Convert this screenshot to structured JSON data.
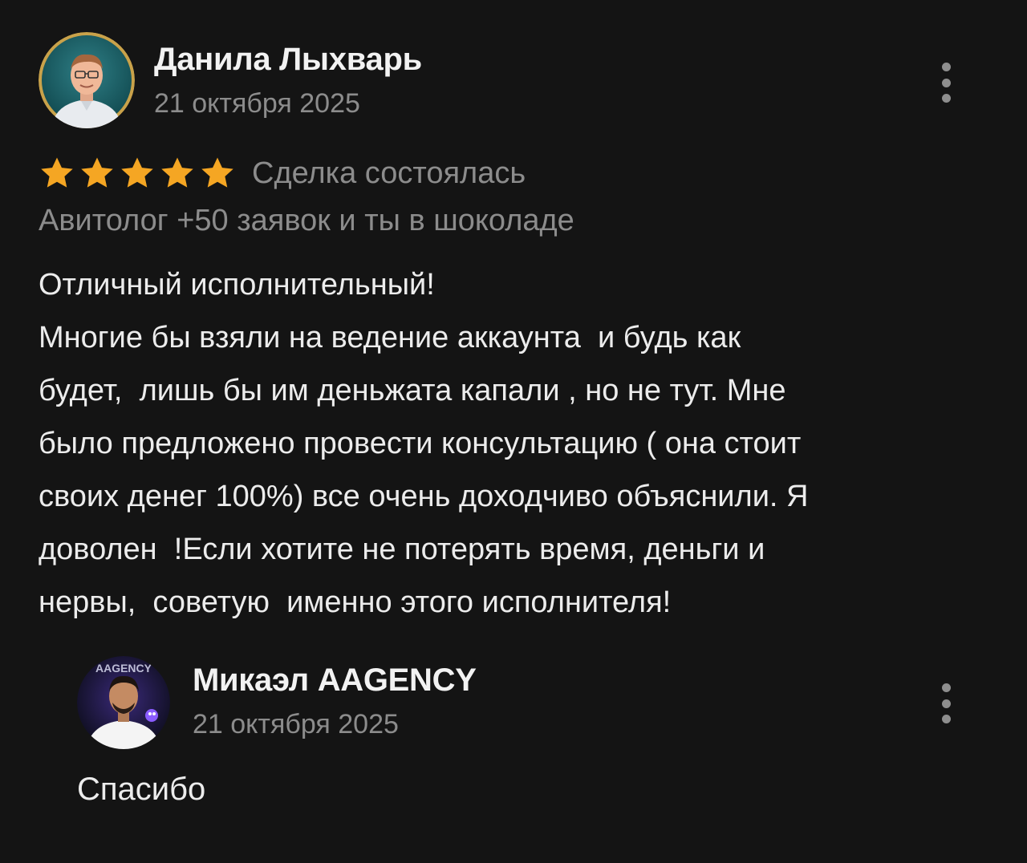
{
  "review": {
    "author": {
      "name": "Данила Лыхварь",
      "date": "21 октября 2025",
      "avatar_icon": "user-photo-avatar"
    },
    "rating": {
      "stars": 5,
      "max": 5,
      "star_color": "#f5a623"
    },
    "deal_status": "Сделка состоялась",
    "service_title": "Авитолог +50 заявок и ты в шоколаде",
    "text_lines": [
      "Отличный исполнительный!",
      "Многие бы взяли на ведение аккаунта  и будь как",
      "будет,  лишь бы им деньжата капали , но не тут. Мне",
      "было предложено провести консультацию ( она стоит",
      "своих денег 100%) все очень доходчиво объяснили. Я",
      "доволен  !Если хотите не потерять время, деньги и",
      "нервы,  советую  именно этого исполнителя!"
    ],
    "menu_icon": "more-vertical-icon"
  },
  "reply": {
    "author": {
      "name": "Микаэл AAGENCY",
      "date": "21 октября 2025",
      "avatar_icon": "user-photo-avatar",
      "avatar_logo_text": "AAGENCY"
    },
    "text": "Спасибо",
    "menu_icon": "more-vertical-icon"
  },
  "colors": {
    "background": "#141414",
    "primary_text": "#ececec",
    "secondary_text": "#8c8c8c",
    "star": "#f5a623",
    "menu_dots": "#8e8e8e"
  }
}
